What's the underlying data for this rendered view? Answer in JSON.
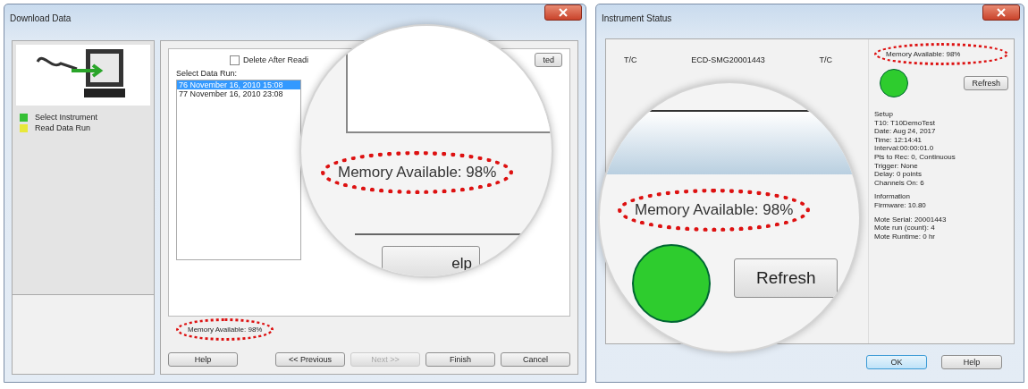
{
  "download_window": {
    "title": "Download Data",
    "steps": [
      {
        "label": "Select Instrument",
        "color": "#35c035"
      },
      {
        "label": "Read Data Run",
        "color": "#e8e83a"
      }
    ],
    "delete_after_reading": {
      "label": "Delete After Readi",
      "checked": false
    },
    "partial_button": "ted",
    "list_label": "Select Data Run:",
    "runs": [
      {
        "label": "76 November 16, 2010 15:08",
        "selected": true
      },
      {
        "label": "77 November 16, 2010 23:08",
        "selected": false
      }
    ],
    "memory": "Memory Available: 98%",
    "buttons": [
      {
        "label": "Help",
        "disabled": false
      },
      {
        "label": "<< Previous",
        "disabled": false
      },
      {
        "label": "Next >>",
        "disabled": true
      },
      {
        "label": "Finish",
        "disabled": false
      },
      {
        "label": "Cancel",
        "disabled": false
      }
    ],
    "magnifier": {
      "memory": "Memory Available: 98%",
      "button": "elp"
    }
  },
  "status_window": {
    "title": "Instrument Status",
    "channels": [
      "T/C",
      "ECD-SMG20001443",
      "T/C"
    ],
    "memory": "Memory Available: 98%",
    "refresh": "Refresh",
    "info_groups": [
      [
        "Setup",
        "T10: T10DemoTest",
        "Date: Aug 24, 2017",
        "Time: 12:14:41",
        "Interval:00:00:01.0",
        "Pts to Rec: 0, Continuous",
        "Trigger: None",
        "Delay: 0 points",
        "Channels On: 6"
      ],
      [
        "Information",
        "Firmware: 10.80"
      ],
      [
        "Mote Serial: 20001443",
        "Mote run (count): 4",
        "Mote Runtime: 0 hr"
      ]
    ],
    "buttons": [
      {
        "label": "OK",
        "selected": true
      },
      {
        "label": "Help",
        "selected": false
      }
    ],
    "magnifier": {
      "memory": "Memory Available: 98%",
      "refresh": "Refresh"
    }
  }
}
